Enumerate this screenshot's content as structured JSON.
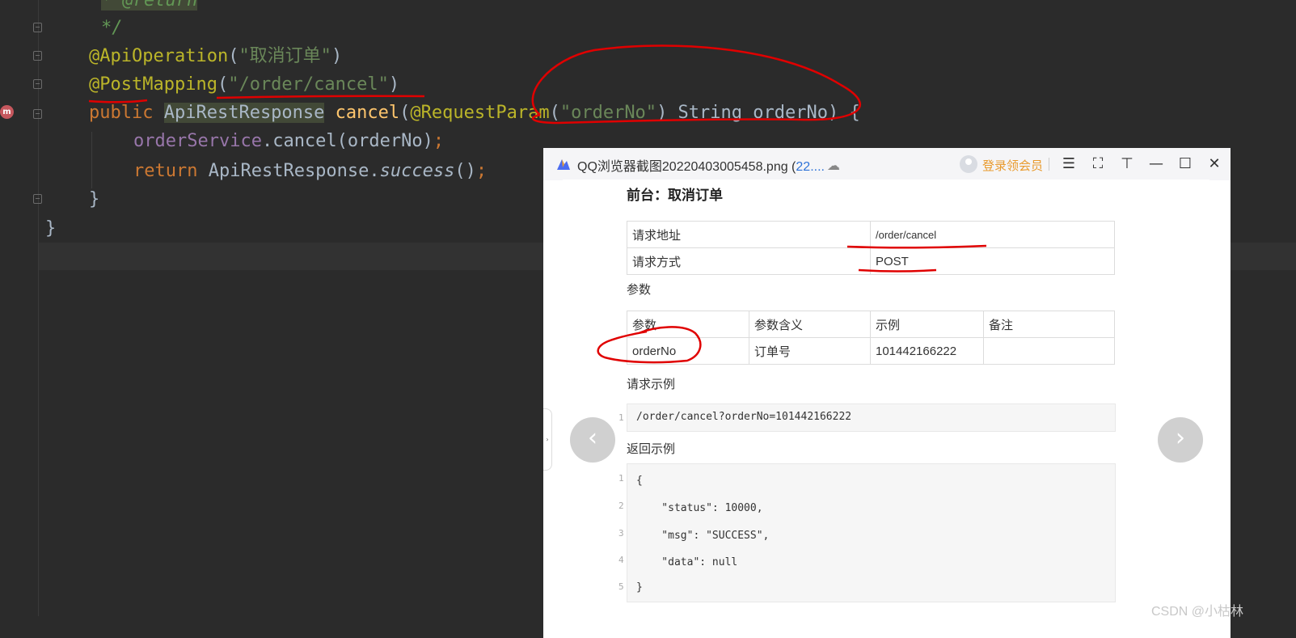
{
  "editor": {
    "lines": {
      "l0": "* @return",
      "l1": "*/",
      "l2_ann": "@ApiOperation",
      "l2_open": "(",
      "l2_str": "\"取消订单\"",
      "l2_close": ")",
      "l3_ann": "@PostMapping",
      "l3_open": "(",
      "l3_str": "\"/order/cancel\"",
      "l3_close": ")",
      "l4_kw": "public",
      "l4_type": "ApiRestResponse",
      "l4_method": "cancel",
      "l4_open": "(",
      "l4_ann": "@RequestParam",
      "l4_open2": "(",
      "l4_str": "\"orderNo\"",
      "l4_rest": ") String orderNo) {",
      "l5_field": "orderService",
      "l5_rest": ".cancel(orderNo)",
      "l5_semi": ";",
      "l6_kw": "return",
      "l6_type": "ApiRestResponse.",
      "l6_call": "success",
      "l6_rest": "()",
      "l6_semi": ";",
      "l7": "}",
      "l8": "}"
    },
    "gutter_marker": "m"
  },
  "viewer": {
    "title_main": "QQ浏览器截图20220403005458.png (",
    "title_size": "22....",
    "login_label": "登录领会员",
    "icons": [
      "cloud-upload-icon",
      "menu-icon",
      "fullscreen-icon",
      "pin-icon",
      "minimize-icon",
      "maximize-icon",
      "close-icon"
    ],
    "prev_glyph": "‹",
    "next_glyph": "›",
    "side_glyph": "›"
  },
  "doc": {
    "heading": "前台：取消订单",
    "request": [
      {
        "label": "请求地址",
        "value": "/order/cancel"
      },
      {
        "label": "请求方式",
        "value": "POST"
      }
    ],
    "params_title": "参数",
    "param_headers": [
      "参数",
      "参数含义",
      "示例",
      "备注"
    ],
    "param_rows": [
      [
        "orderNo",
        "订单号",
        "101442166222",
        ""
      ]
    ],
    "request_example_title": "请求示例",
    "request_example": {
      "ln": "1",
      "code": "/order/cancel?orderNo=101442166222"
    },
    "response_example_title": "返回示例",
    "response_lines": [
      {
        "ln": "1",
        "code": "{"
      },
      {
        "ln": "2",
        "code": "    \"status\": 10000,"
      },
      {
        "ln": "3",
        "code": "    \"msg\": \"SUCCESS\","
      },
      {
        "ln": "4",
        "code": "    \"data\": null"
      },
      {
        "ln": "5",
        "code": "}"
      }
    ]
  },
  "watermark": "CSDN @小枯林",
  "colors": {
    "editor_bg": "#2b2b2b",
    "keyword": "#cc7832",
    "annotation": "#bbb529",
    "string": "#6a8759",
    "method": "#ffc66d",
    "field": "#9876aa",
    "pen": "#e00000",
    "login": "#e99a2c"
  }
}
